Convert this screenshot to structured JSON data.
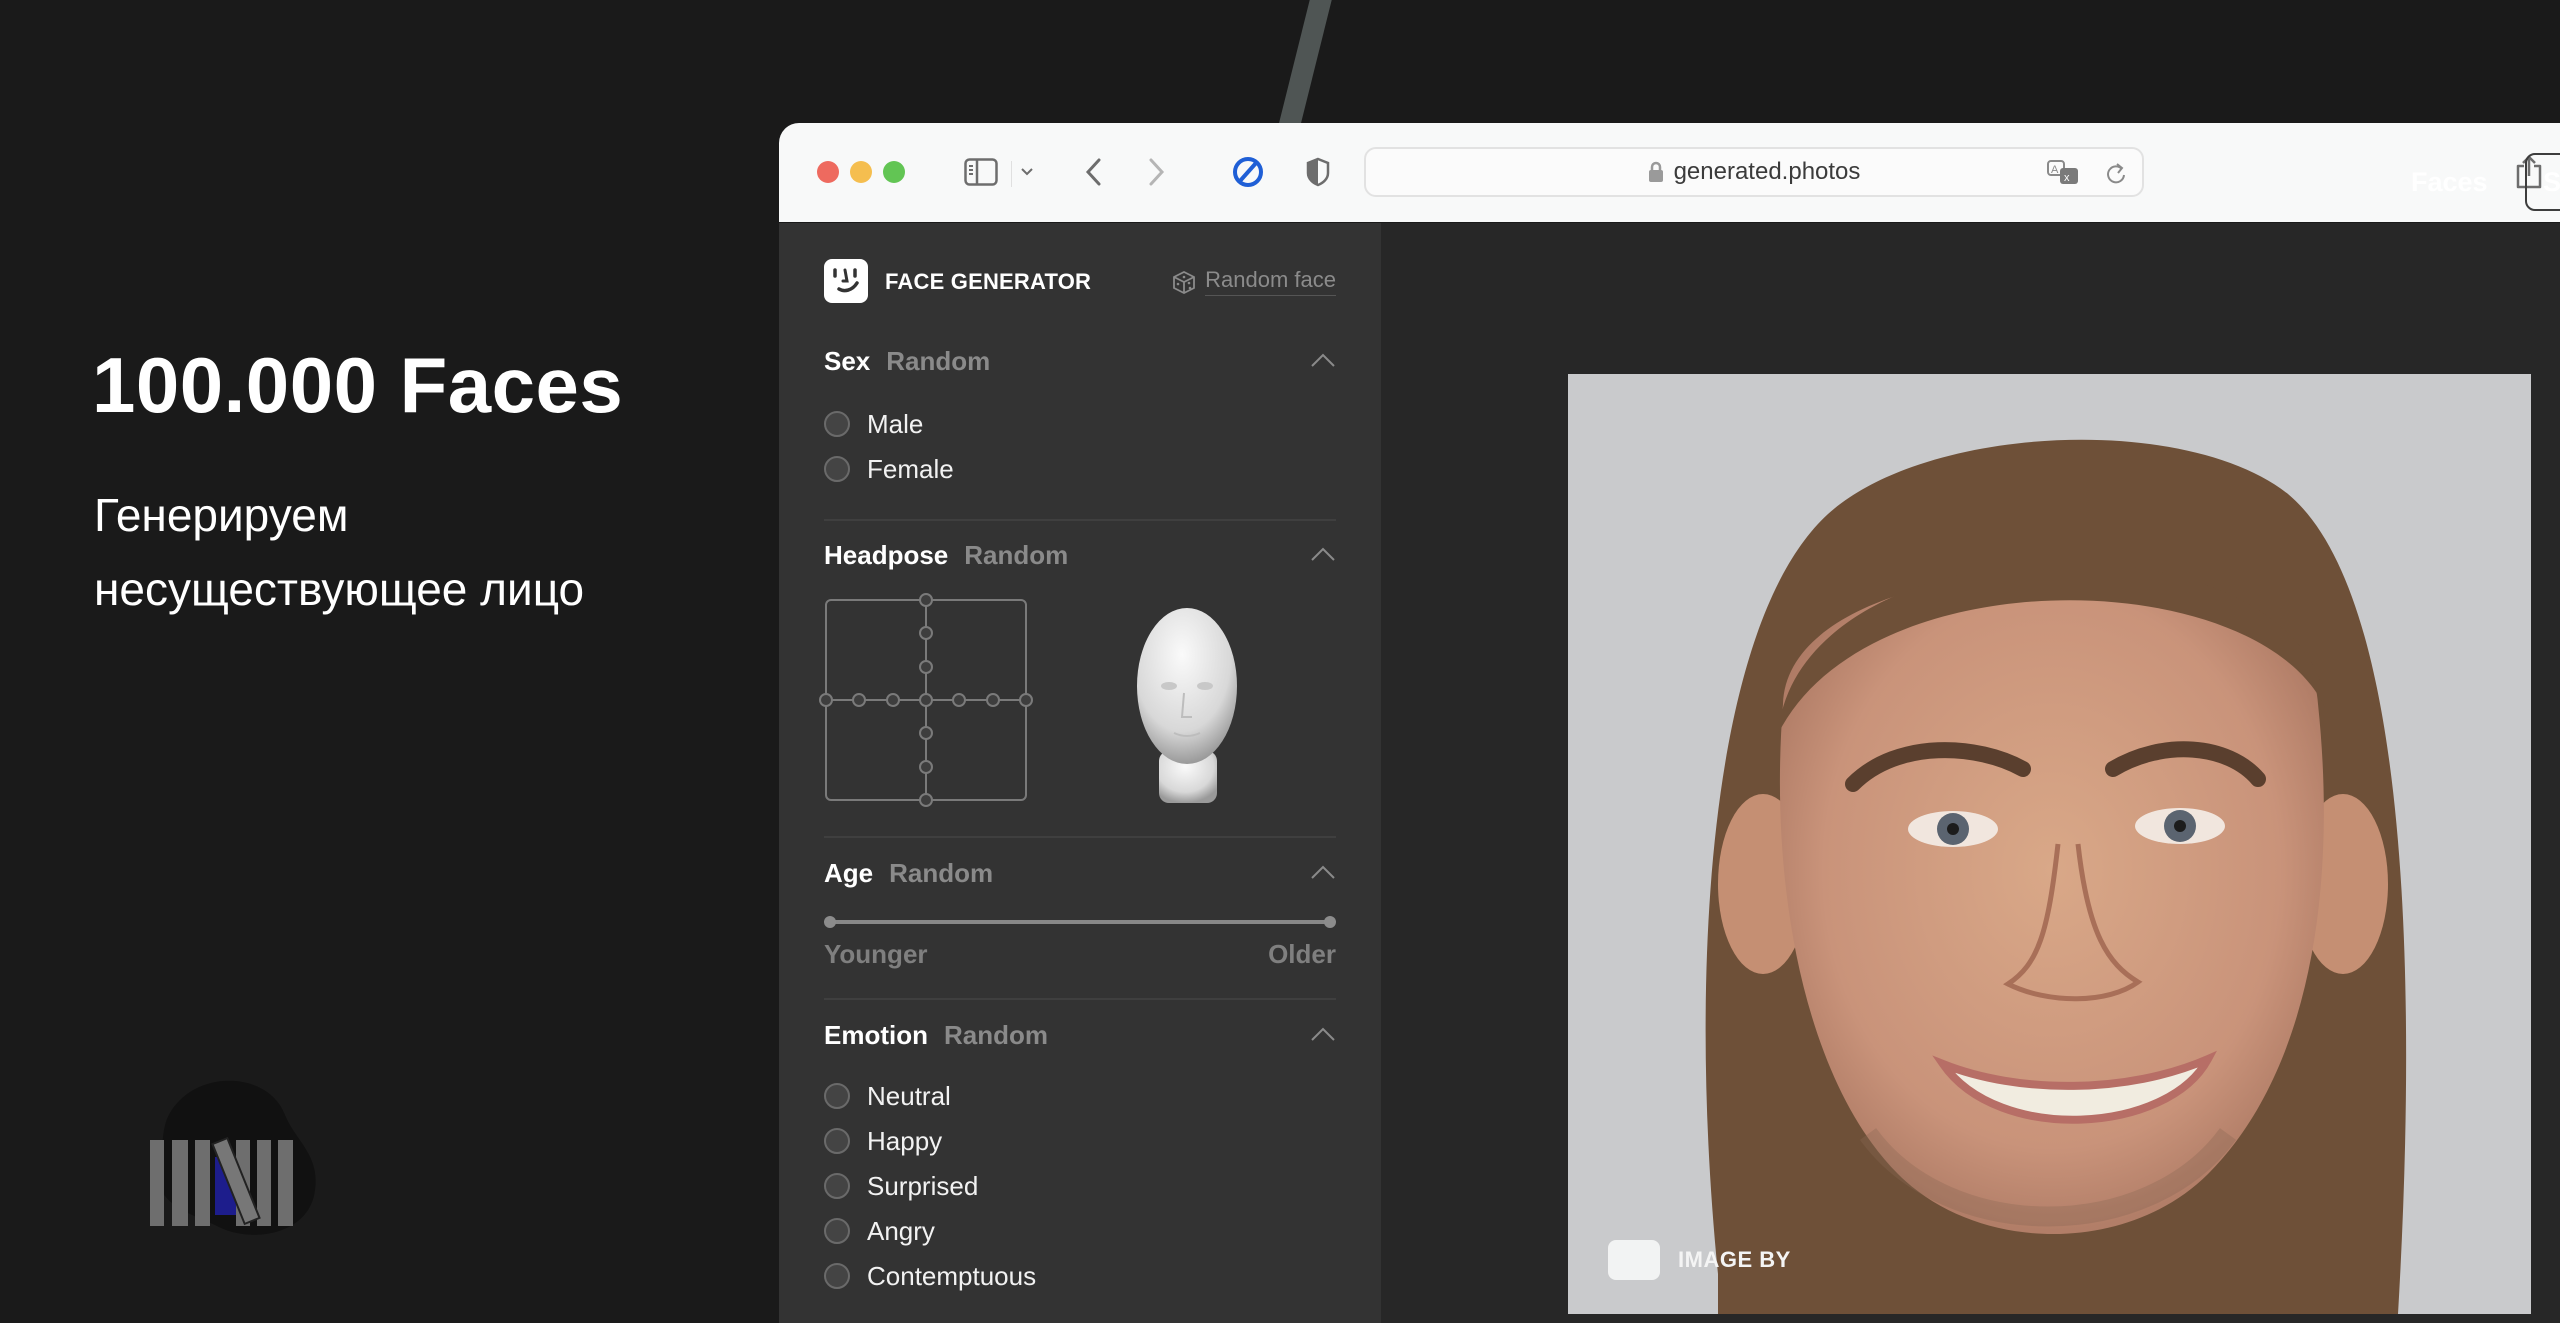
{
  "hero": {
    "title": "100.000 Faces",
    "subtitle_line1": "Генерируем",
    "subtitle_line2": "несуществующее лицо"
  },
  "brand_logo": {
    "icon": "fence-planks-logo"
  },
  "browser": {
    "url": "generated.photos",
    "icons": [
      "sidebar-toggle-icon",
      "chevron-down-icon",
      "back-icon",
      "forward-icon",
      "block-icon",
      "shield-icon",
      "lock-icon",
      "translate-icon",
      "reload-icon",
      "share-icon"
    ]
  },
  "sidebar": {
    "app_title": "FACE GENERATOR",
    "random_face_label": "Random face",
    "sections": {
      "sex": {
        "name": "Sex",
        "value": "Random",
        "options": [
          "Male",
          "Female"
        ]
      },
      "headpose": {
        "name": "Headpose",
        "value": "Random"
      },
      "age": {
        "name": "Age",
        "value": "Random",
        "min_label": "Younger",
        "max_label": "Older",
        "range": [
          0,
          1
        ]
      },
      "emotion": {
        "name": "Emotion",
        "value": "Random",
        "options": [
          "Neutral",
          "Happy",
          "Surprised",
          "Angry",
          "Contemptuous"
        ]
      }
    }
  },
  "main": {
    "nav_faces": "Faces",
    "nav_button_partial": "S",
    "watermark": "IMAGE BY"
  },
  "colors": {
    "page_bg": "#1a1a1a",
    "sidebar_bg": "#333333",
    "main_bg": "#272727",
    "toolbar_bg": "#f8f9f9",
    "muted_text": "#8a8a8a",
    "block_icon_blue": "#1f5fd6"
  }
}
